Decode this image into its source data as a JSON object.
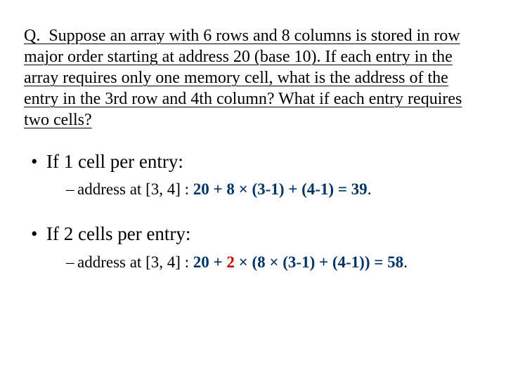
{
  "question": "Q.  Suppose an array with 6 rows and 8 columns is stored in row major order starting at address 20 (base 10). If each entry in the array requires only one memory cell, what is the address of the entry in the 3rd row and 4th column? What if each entry requires two cells?",
  "b1": {
    "title": "If 1 cell per entry:",
    "sub_prefix": "address at [3, 4] : ",
    "sub_bold": "20 + 8 × (3-1) + (4-1) = 39",
    "sub_suffix": "."
  },
  "b2": {
    "title": "If 2 cells per entry:",
    "sub_prefix": "address at [3, 4] : ",
    "p1": "20 + ",
    "p2_red": "2",
    "p3": " × (8 × (3-1) + (4-1)) = 58",
    "sub_suffix": "."
  }
}
